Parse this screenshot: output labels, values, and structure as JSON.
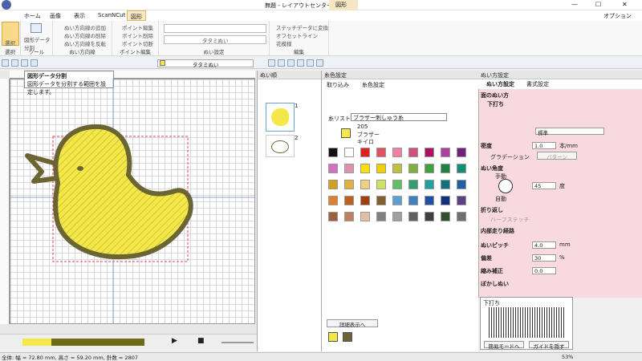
{
  "title": "無題 - レイアウトセンター",
  "context_tab": "図形",
  "options": "オプション",
  "tabs": [
    "ホーム",
    "画像",
    "表示",
    "ScanNCut",
    "図形"
  ],
  "ribbon": {
    "select": "選択",
    "select_group": "選択",
    "split": "図形データ分割",
    "tool_group": "ツール",
    "dir_add": "ぬい方向線の追加",
    "dir_del": "ぬい方向線の削除",
    "dir_flip": "ぬい方向線を反転",
    "dir_group": "ぬい方向線",
    "pt_edit": "ポイント編集",
    "pt_del": "ポイント削除",
    "pt_cut": "ポイント切断",
    "pt_group": "ポイント編集",
    "stitch_name": "タタミぬい",
    "stitch_group": "ぬい設定",
    "to_stitch": "ステッチデータに変換",
    "offset": "オフセットライン",
    "flower": "花模様",
    "edit_group": "編集"
  },
  "toolbar": {
    "stitch_name": "タタミぬい"
  },
  "tooltip": {
    "title": "図形データ分割",
    "desc": "図形データを分割する範囲を設定します。"
  },
  "order_panel": {
    "title": "ぬい順",
    "items": [
      "1",
      "2"
    ]
  },
  "thread_panel": {
    "title": "糸色設定",
    "tab1": "取り込み",
    "tab2": "糸色設定",
    "list_label": "糸リスト:",
    "list_value": "ブラザー刺しゅう糸",
    "code": "205",
    "brand": "ブラザー",
    "color_name": "キイロ",
    "detail_btn": "詳細表示へ"
  },
  "sew_panel": {
    "title": "ぬい方設定",
    "tab1": "ぬい方設定",
    "tab2": "書式設定",
    "section": "面のぬい方",
    "underlay": "下打ち",
    "density_label": "密度",
    "density": "標準",
    "density_v": "1.0",
    "density_unit": "本/mm",
    "gradation": "グラデーション",
    "pattern": "パターン",
    "direction": "ぬい角度",
    "manual": "手動",
    "angle": "45",
    "deg": "度",
    "auto": "自動",
    "fold": "折り返し",
    "half": "ハーフステッチ",
    "path": "内部走り経路",
    "pitch": "ぬいピッチ",
    "pitch_v": "4.0",
    "mm": "mm",
    "offset": "偏差",
    "offset_v": "30",
    "pct": "%",
    "comp": "縮み補正",
    "comp_v": "0.0",
    "blur": "ぼかしぬい",
    "preview": "下打ち",
    "easy": "簡易モードへ",
    "guide": "ガイドを隠す"
  },
  "status": {
    "text": "全体: 幅 = 72.80 mm, 高さ = 59.20 mm, 針数 = 2807",
    "zoom": "53%"
  },
  "colors": {
    "bird": "#f3e74a",
    "outline": "#6b6534",
    "panel": "#f8d9df"
  }
}
